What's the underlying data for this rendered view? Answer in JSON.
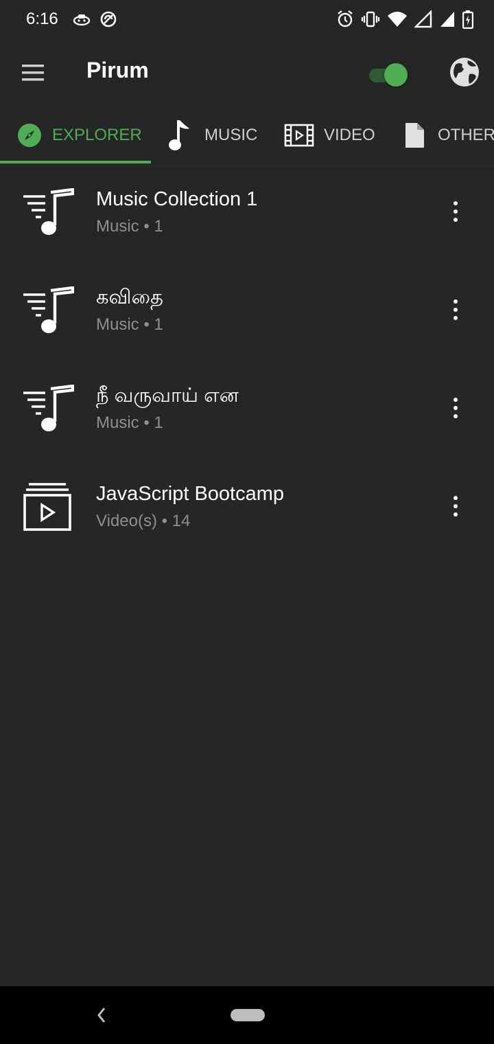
{
  "status_bar": {
    "time": "6:16"
  },
  "app_bar": {
    "title": "Pirum",
    "toggle_on": true
  },
  "tabs": [
    {
      "label": "EXPLORER",
      "icon": "compass-icon",
      "active": true
    },
    {
      "label": "MUSIC",
      "icon": "music-note-icon",
      "active": false
    },
    {
      "label": "VIDEO",
      "icon": "film-icon",
      "active": false
    },
    {
      "label": "OTHERS",
      "icon": "file-icon",
      "active": false
    }
  ],
  "items": [
    {
      "title": "Music Collection 1",
      "subtitle": "Music • 1",
      "icon": "playlist-music-icon"
    },
    {
      "title": "கவிதை",
      "subtitle": "Music • 1",
      "icon": "playlist-music-icon"
    },
    {
      "title": "நீ வருவாய் என",
      "subtitle": "Music • 1",
      "icon": "playlist-music-icon"
    },
    {
      "title": "JavaScript Bootcamp",
      "subtitle": "Video(s) • 14",
      "icon": "playlist-video-icon"
    }
  ],
  "colors": {
    "accent": "#4caf50",
    "background": "#262626",
    "secondary_text": "#8f8f8f"
  }
}
